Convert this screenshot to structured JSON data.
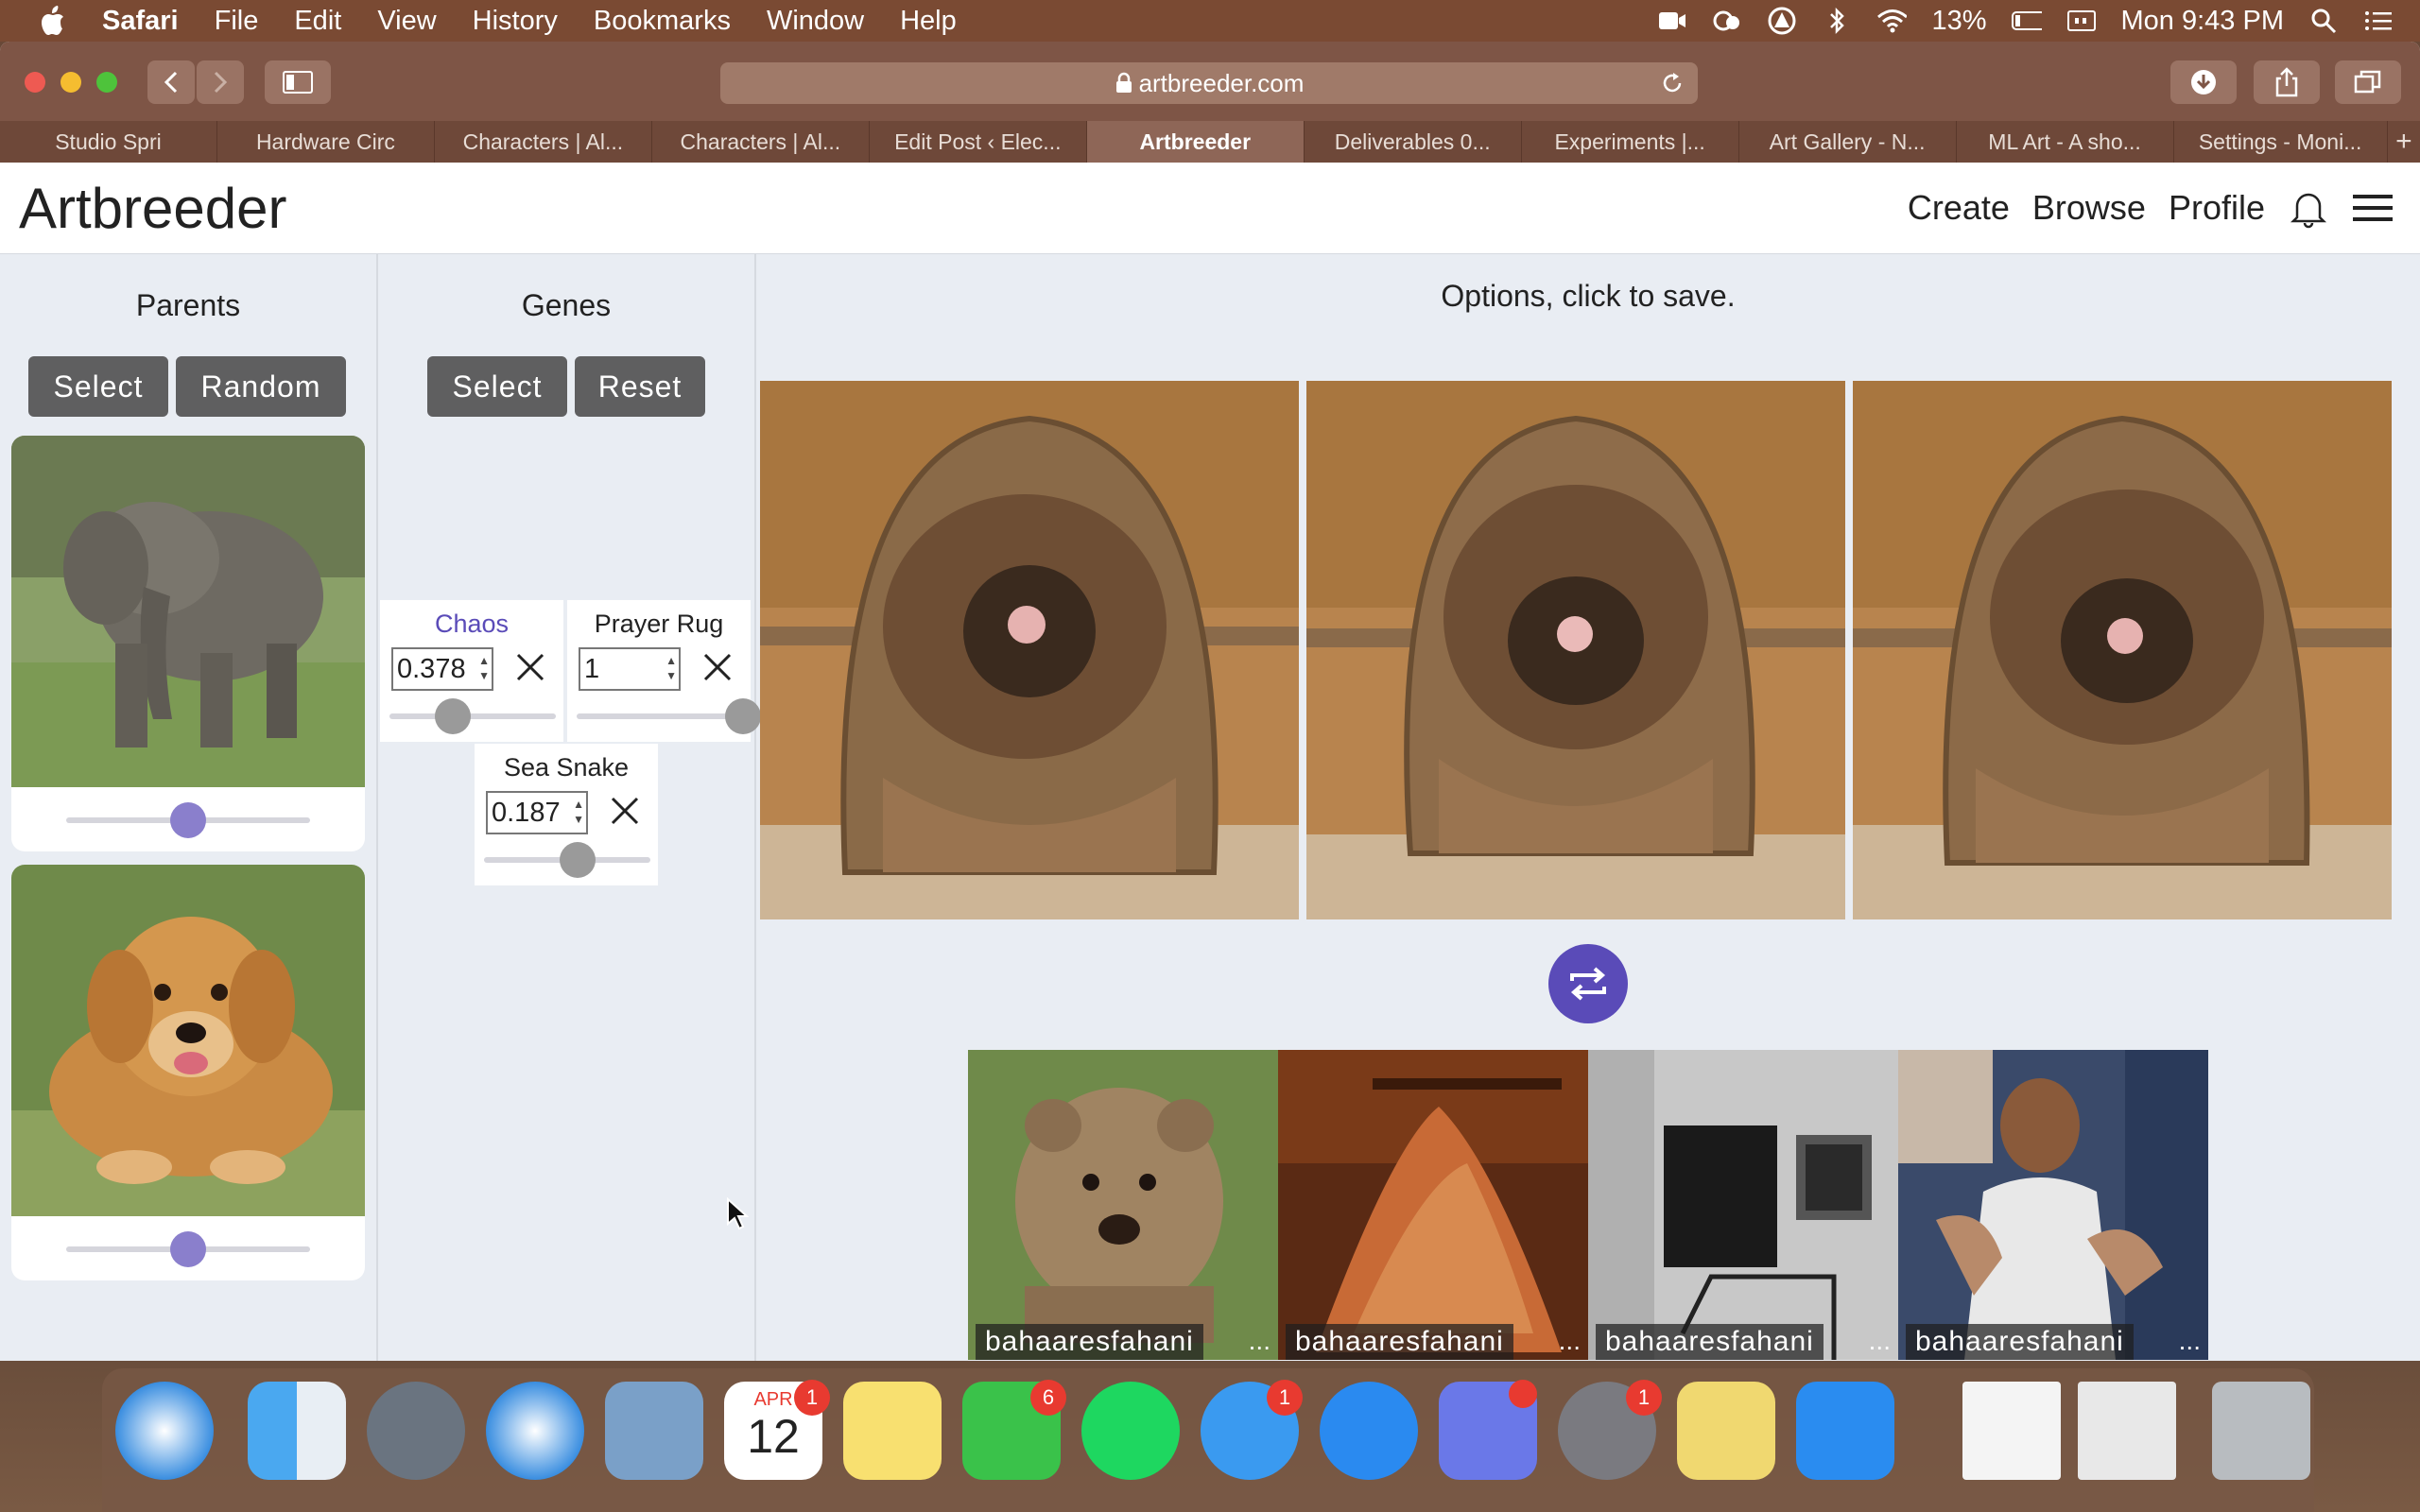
{
  "menubar": {
    "app": "Safari",
    "items": [
      "File",
      "Edit",
      "View",
      "History",
      "Bookmarks",
      "Window",
      "Help"
    ],
    "battery": "13%",
    "clock": "Mon 9:43 PM"
  },
  "browser": {
    "url": "artbreeder.com",
    "tabs": [
      "Studio Spri",
      "Hardware Circ",
      "Characters | Al...",
      "Characters | Al...",
      "Edit Post ‹ Elec...",
      "Artbreeder",
      "Deliverables 0...",
      "Experiments |...",
      "Art Gallery - N...",
      "ML Art - A sho...",
      "Settings - Moni..."
    ],
    "active_tab": 5,
    "new_tab": "+"
  },
  "site": {
    "logo": "Artbreeder",
    "nav": [
      "Create",
      "Browse",
      "Profile"
    ]
  },
  "parents": {
    "title": "Parents",
    "select_label": "Select",
    "random_label": "Random",
    "items": [
      {
        "subject": "elephant",
        "slider": 0.5
      },
      {
        "subject": "dog",
        "slider": 0.5
      }
    ]
  },
  "genes": {
    "title": "Genes",
    "select_label": "Select",
    "reset_label": "Reset",
    "items": [
      {
        "name": "Chaos",
        "value": "0.378",
        "slider": 0.38,
        "highlight": true
      },
      {
        "name": "Prayer Rug",
        "value": "1",
        "slider": 1.0,
        "highlight": false
      },
      {
        "name": "Sea Snake",
        "value": "0.187",
        "slider": 0.56,
        "highlight": false
      }
    ]
  },
  "options": {
    "title": "Options, click to save."
  },
  "results": [
    {
      "user": "bahaaresfahani",
      "more": "..."
    },
    {
      "user": "bahaaresfahani",
      "more": "..."
    },
    {
      "user": "bahaaresfahani",
      "more": "..."
    },
    {
      "user": "bahaaresfahani",
      "more": "..."
    }
  ],
  "dock": {
    "calendar_month": "APR",
    "calendar_day": "12",
    "badges": {
      "calendar": "1",
      "facetime": "6",
      "messages": "1",
      "settings": "1"
    }
  },
  "colors": {
    "accent": "#5a4bb8",
    "slider_knob": "#8a7fcc",
    "gene_knob": "#9a9a9a",
    "button": "#5f5f60"
  }
}
